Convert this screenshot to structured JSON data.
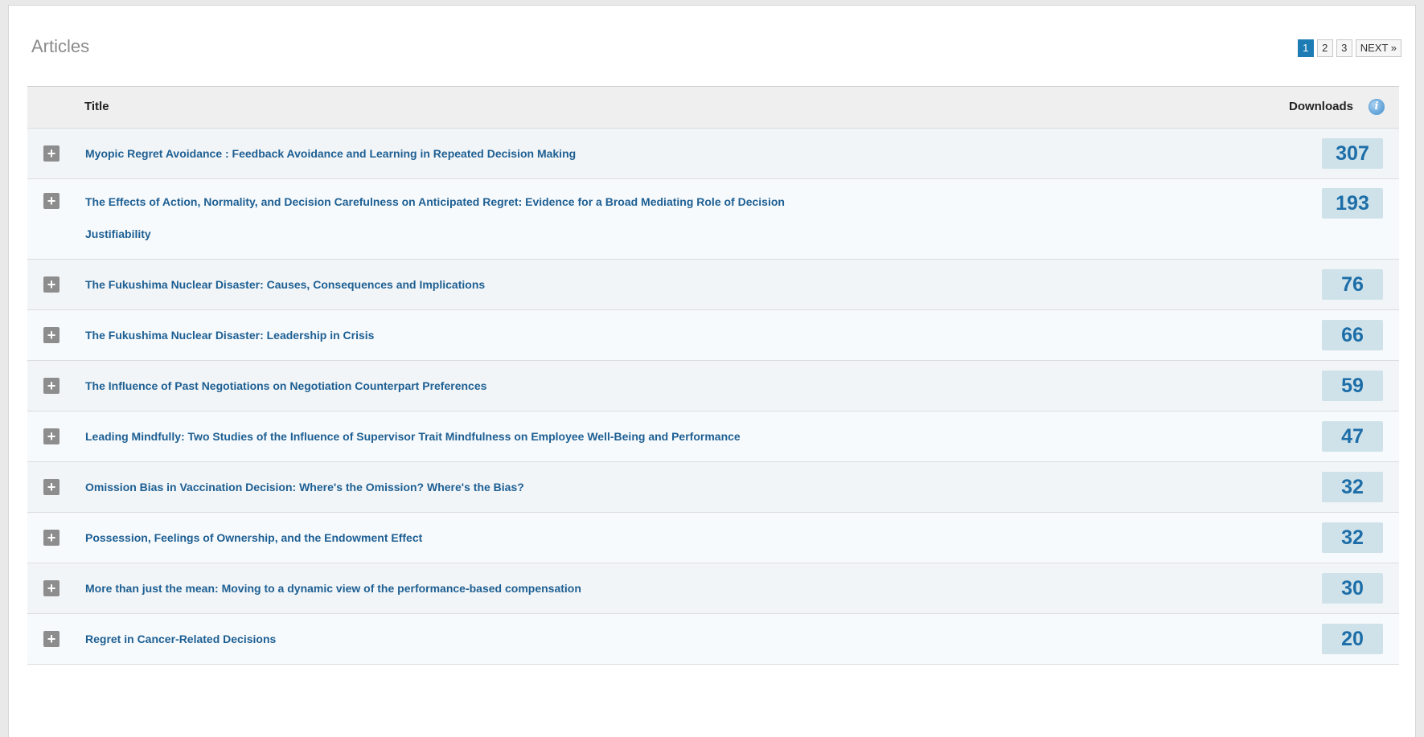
{
  "panel": {
    "title": "Articles"
  },
  "pagination": {
    "pages": [
      "1",
      "2",
      "3"
    ],
    "active": "1",
    "next_label": "NEXT »"
  },
  "table": {
    "col_title": "Title",
    "col_downloads": "Downloads",
    "info_icon": "info-icon",
    "expand_icon": "plus-icon",
    "rows": [
      {
        "title_line1": "Myopic Regret Avoidance : Feedback Avoidance and Learning in Repeated Decision Making",
        "title_line2": "",
        "downloads": "307"
      },
      {
        "title_line1": "The Effects of Action, Normality, and Decision Carefulness on Anticipated Regret: Evidence for a Broad Mediating Role of Decision",
        "title_line2": "Justifiability",
        "downloads": "193"
      },
      {
        "title_line1": "The Fukushima Nuclear Disaster: Causes, Consequences and Implications",
        "title_line2": "",
        "downloads": "76"
      },
      {
        "title_line1": "The Fukushima Nuclear Disaster: Leadership in Crisis",
        "title_line2": "",
        "downloads": "66"
      },
      {
        "title_line1": "The Influence of Past Negotiations on Negotiation Counterpart Preferences",
        "title_line2": "",
        "downloads": "59"
      },
      {
        "title_line1": "Leading Mindfully: Two Studies of the Influence of Supervisor Trait Mindfulness on Employee Well-Being and Performance",
        "title_line2": "",
        "downloads": "47"
      },
      {
        "title_line1": "Omission Bias in Vaccination Decision: Where's the Omission? Where's the Bias?",
        "title_line2": "",
        "downloads": "32"
      },
      {
        "title_line1": "Possession, Feelings of Ownership, and the Endowment Effect",
        "title_line2": "",
        "downloads": "32"
      },
      {
        "title_line1": "More than just the mean: Moving to a dynamic view of the performance-based compensation",
        "title_line2": "",
        "downloads": "30"
      },
      {
        "title_line1": "Regret in Cancer-Related Decisions",
        "title_line2": "",
        "downloads": "20"
      }
    ]
  },
  "colors": {
    "accent": "#1e7cb4",
    "link": "#1d5f93",
    "count_bg": "#cfe2ea",
    "count_text": "#1d6ea8"
  }
}
